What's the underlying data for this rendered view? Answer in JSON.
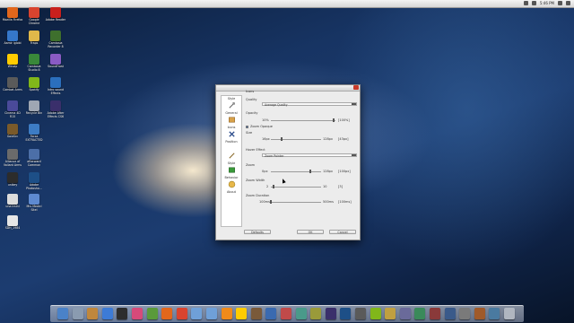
{
  "menubar": {
    "clock": "5:46 PM"
  },
  "desktop_icons": [
    {
      "label": "Mozilla Firefox",
      "color": "#e2671c"
    },
    {
      "label": "Google Chrome",
      "color": "#d9442f"
    },
    {
      "label": "Adobe Reader",
      "color": "#c8201c"
    },
    {
      "label": "Aamir iglobi",
      "color": "#3577c9"
    },
    {
      "label": "Fraps",
      "color": "#e0b84a"
    },
    {
      "label": "Camtasia Recorder 8",
      "color": "#3e6f2d"
    },
    {
      "label": "Winzip",
      "color": "#ffcc00"
    },
    {
      "label": "Camtasia Studio 8",
      "color": "#39883a"
    },
    {
      "label": "SoundFrost",
      "color": "#8a5bc4"
    },
    {
      "label": "Combat Arms",
      "color": "#5a5a5a"
    },
    {
      "label": "Spotify",
      "color": "#81b71a"
    },
    {
      "label": "Intro sound Effects",
      "color": "#2b6fbd"
    },
    {
      "label": "Cinema 4D R15",
      "color": "#4a4a9a"
    },
    {
      "label": "Recycle Bin",
      "color": "#9fa7b3"
    },
    {
      "label": "Adobe After Effects CS6",
      "color": "#3a2f6b"
    },
    {
      "label": "GoldSrc",
      "color": "#7a5a2a"
    },
    {
      "label": "Forza EXTRACTED",
      "color": "#3d7cc4"
    },
    {
      "label": "Alliance of Valiant Arms",
      "color": "#6b6b6b"
    },
    {
      "label": "afterward Common",
      "color": "#4c6fa8"
    },
    {
      "label": "unikey",
      "color": "#2c2c2c"
    },
    {
      "label": "Adobe Photosho...",
      "color": "#1d4f87"
    },
    {
      "label": "una tmini",
      "color": "#dcdcdc"
    },
    {
      "label": "Mrs Medici Sitel",
      "color": "#5e8ad1"
    },
    {
      "label": "SDH_1984",
      "color": "#e6e6e6"
    }
  ],
  "dialog": {
    "sidebar": [
      {
        "label": "Style",
        "icon": "style-icon"
      },
      {
        "label": "General",
        "icon": "wrench-icon"
      },
      {
        "label": "Icons",
        "icon": "box-icon"
      },
      {
        "label": "Position",
        "icon": "cross-arrows-icon"
      },
      {
        "label": "Style",
        "icon": "pen-icon"
      },
      {
        "label": "Behavior",
        "icon": "window-icon"
      },
      {
        "label": "About",
        "icon": "info-icon"
      }
    ],
    "section": "Icons",
    "quality_label": "Quality",
    "quality_value": "Average Quality",
    "opacity_label": "Opacity",
    "opacity_min": "10%",
    "opacity_max": "[100%]",
    "opacity_fraction": 0.97,
    "zoom_opaque_label": "Zoom Opaque",
    "zoom_opaque_checked": true,
    "size_label": "Size",
    "size_min": "16px",
    "size_max": "128px",
    "size_value": "[43px]",
    "size_fraction": 0.22,
    "hover_effect_label": "Hover Effect",
    "hover_effect_value": "Zoom Pointer",
    "zoom_label": "Zoom",
    "zoom_min": "0px",
    "zoom_max": "128px",
    "zoom_value": "[100px]",
    "zoom_fraction": 0.78,
    "zoom_width_label": "Zoom Width",
    "zoom_width_min": "2",
    "zoom_width_max": "10",
    "zoom_width_value": "[3]",
    "zoom_width_fraction": 0.06,
    "zoom_duration_label": "Zoom Duration",
    "zoom_duration_min": "100ms",
    "zoom_duration_max": "500ms",
    "zoom_duration_value": "[100ms]",
    "zoom_duration_fraction": 0.0,
    "btn_defaults": "Defaults",
    "btn_ok": "OK",
    "btn_cancel": "Cancel"
  },
  "dock": [
    {
      "name": "finder-icon",
      "color": "#4a82c8"
    },
    {
      "name": "launchpad-icon",
      "color": "#8a9bb0"
    },
    {
      "name": "photo-icon",
      "color": "#c0873c"
    },
    {
      "name": "ie-icon",
      "color": "#3d7bd6"
    },
    {
      "name": "camera-icon",
      "color": "#2d2d2d"
    },
    {
      "name": "itunes-icon",
      "color": "#d64a7a"
    },
    {
      "name": "app-icon",
      "color": "#5a9a3a"
    },
    {
      "name": "firefox-icon",
      "color": "#e2671c"
    },
    {
      "name": "chrome-icon",
      "color": "#d9442f"
    },
    {
      "name": "folder-icon",
      "color": "#6fa0d8"
    },
    {
      "name": "folder-icon",
      "color": "#6fa0d8"
    },
    {
      "name": "vlc-icon",
      "color": "#f08a1a"
    },
    {
      "name": "winzip-icon",
      "color": "#ffcc00"
    },
    {
      "name": "app-icon",
      "color": "#7a5a3a"
    },
    {
      "name": "app-icon",
      "color": "#3a6ab0"
    },
    {
      "name": "app-icon",
      "color": "#c04a4a"
    },
    {
      "name": "app-icon",
      "color": "#4a9a8a"
    },
    {
      "name": "app-icon",
      "color": "#9a9a3a"
    },
    {
      "name": "ae-icon",
      "color": "#3a2f6b"
    },
    {
      "name": "ps-icon",
      "color": "#1d4f87"
    },
    {
      "name": "app-icon",
      "color": "#5a5a5a"
    },
    {
      "name": "spotify-icon",
      "color": "#81b71a"
    },
    {
      "name": "app-icon",
      "color": "#c0a040"
    },
    {
      "name": "app-icon",
      "color": "#6a6a9a"
    },
    {
      "name": "app-icon",
      "color": "#3a8a5a"
    },
    {
      "name": "app-icon",
      "color": "#8a3a3a"
    },
    {
      "name": "app-icon",
      "color": "#3a5a8a"
    },
    {
      "name": "app-icon",
      "color": "#7a7a7a"
    },
    {
      "name": "app-icon",
      "color": "#a05a2a"
    },
    {
      "name": "app-icon",
      "color": "#4a7aa0"
    },
    {
      "name": "trash-icon",
      "color": "#b0b6c0"
    }
  ]
}
